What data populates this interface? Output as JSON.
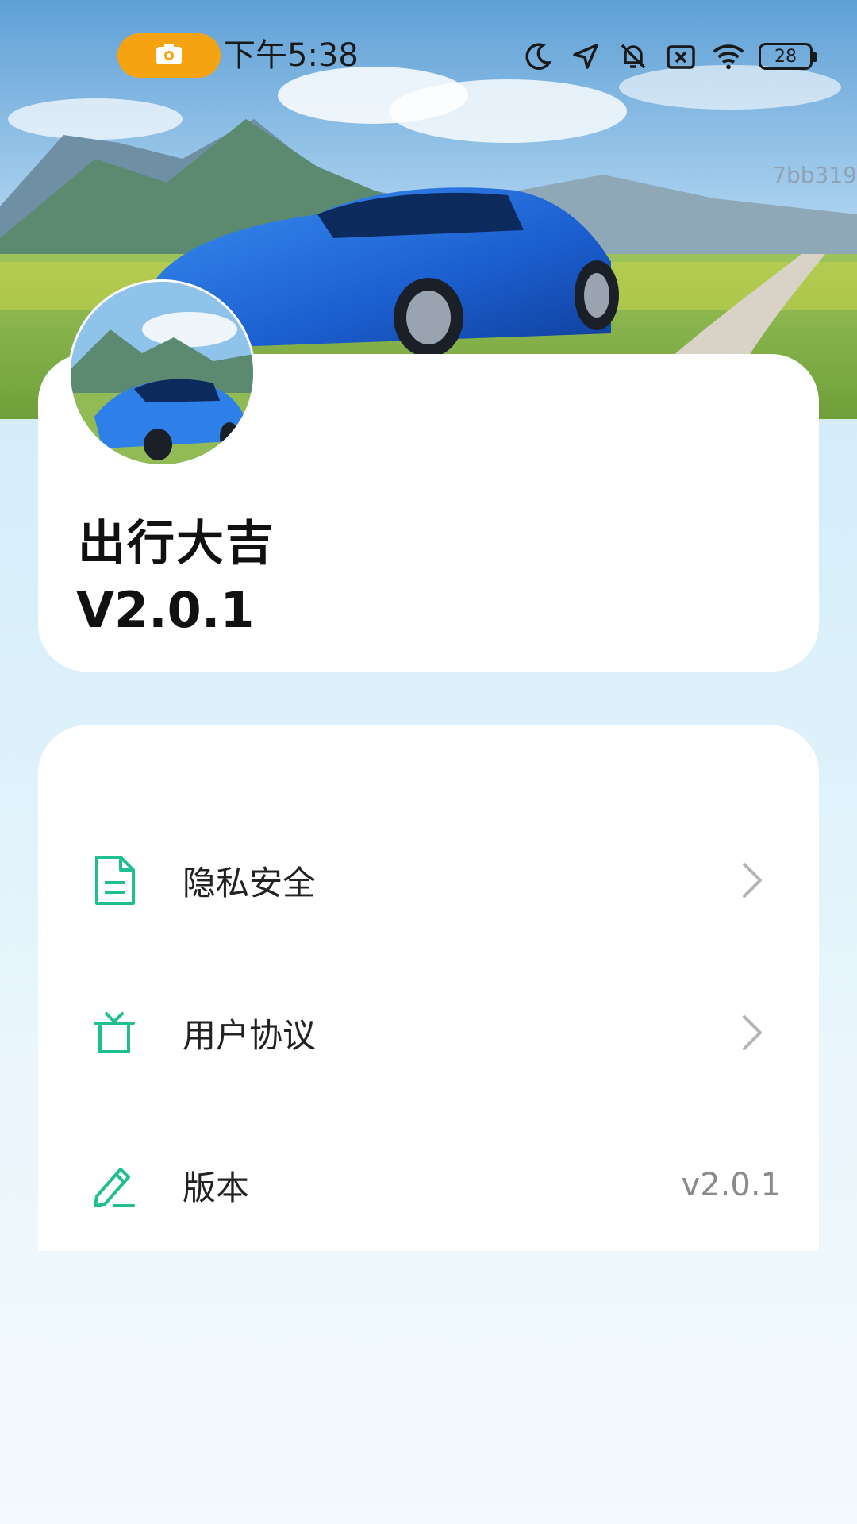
{
  "status_bar": {
    "time": "下午5:38",
    "battery": "28",
    "icons": [
      "camera-icon",
      "moon-icon",
      "location-arrow-icon",
      "bell-off-icon",
      "sim-off-icon",
      "wifi-icon",
      "battery-icon"
    ]
  },
  "watermark": "7bb319",
  "profile": {
    "name": "出行大吉",
    "version": "V2.0.1"
  },
  "menu": {
    "items": [
      {
        "label": "隐私安全",
        "icon": "document-icon"
      },
      {
        "label": "用户协议",
        "icon": "gift-box-icon"
      },
      {
        "label": "版本",
        "icon": "pencil-icon",
        "value": "v2.0.1"
      }
    ]
  },
  "colors": {
    "accent": "#1fbf8f",
    "recording_pill": "#f6a312",
    "background": "#d9effa"
  }
}
